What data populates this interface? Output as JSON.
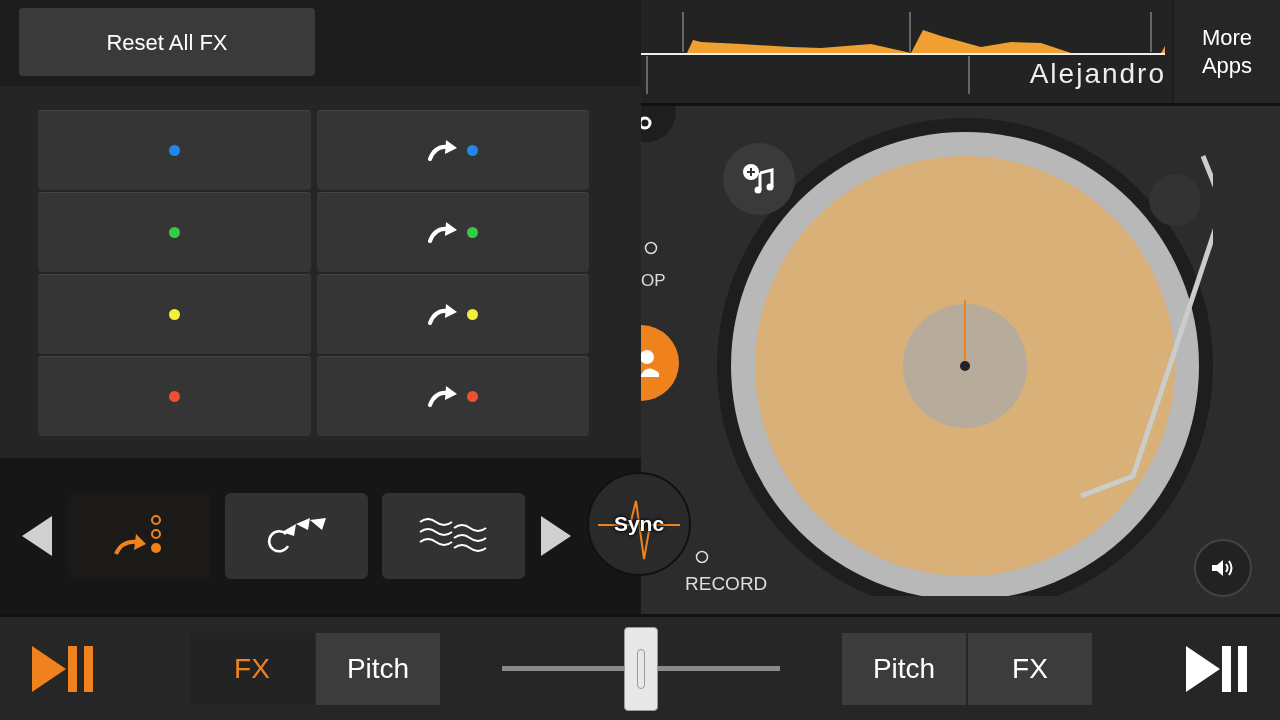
{
  "fx_panel": {
    "reset_button": "Reset All FX",
    "pads": [
      {
        "kind": "dot",
        "color": "#1e88f0"
      },
      {
        "kind": "arrow-dot",
        "color": "#1e88f0"
      },
      {
        "kind": "dot",
        "color": "#33cc44"
      },
      {
        "kind": "arrow-dot",
        "color": "#33cc44"
      },
      {
        "kind": "dot",
        "color": "#f2ee3a"
      },
      {
        "kind": "arrow-dot",
        "color": "#f2ee3a"
      },
      {
        "kind": "dot",
        "color": "#f0502e"
      },
      {
        "kind": "arrow-dot",
        "color": "#f0502e"
      }
    ],
    "effects": [
      {
        "kind": "cue-loop",
        "selected": true
      },
      {
        "kind": "roll",
        "selected": false
      },
      {
        "kind": "wave",
        "selected": false
      }
    ]
  },
  "sync_button": "Sync",
  "record": {
    "label": "RECORD"
  },
  "waveform": {
    "track_title": "Alejandro"
  },
  "more_apps": "More Apps",
  "deck": {
    "partial_label": "OP"
  },
  "crossfader": {
    "level": 0.5
  },
  "transport": {
    "left": {
      "play_active": true,
      "tabs": [
        {
          "label": "FX",
          "selected": true
        },
        {
          "label": "Pitch",
          "selected": false
        }
      ]
    },
    "right": {
      "play_active": false,
      "tabs": [
        {
          "label": "Pitch",
          "selected": false
        },
        {
          "label": "FX",
          "selected": false
        }
      ]
    }
  }
}
